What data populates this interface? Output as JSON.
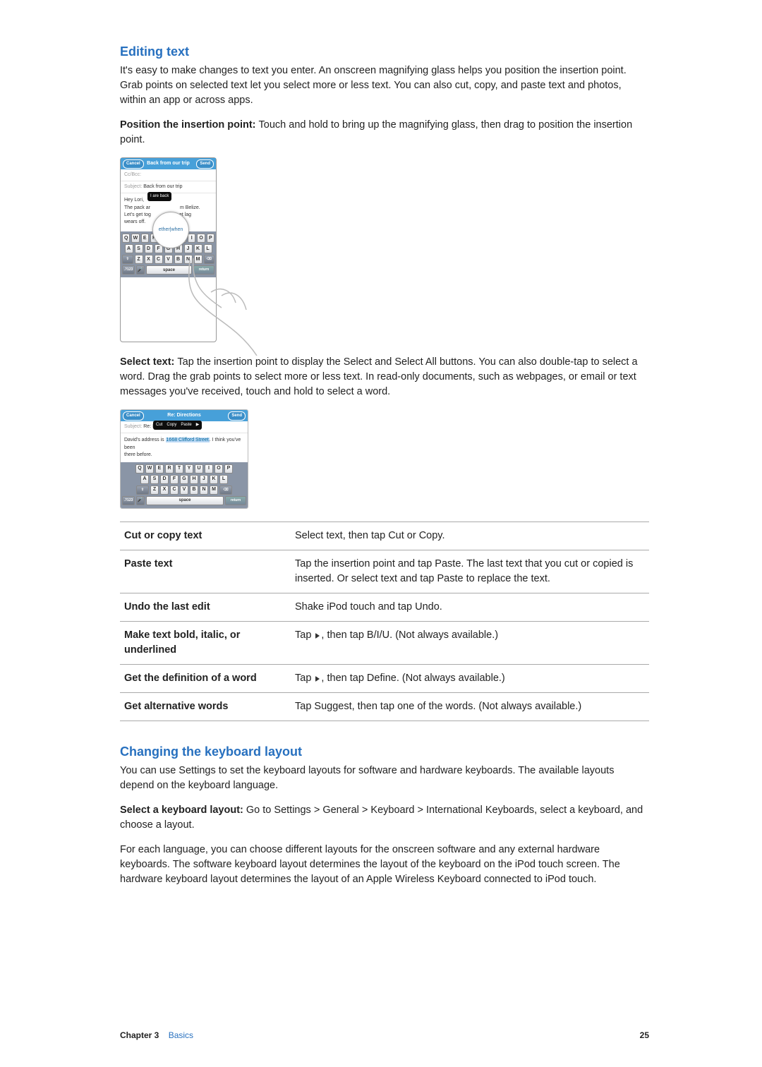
{
  "section1": {
    "heading": "Editing text",
    "intro": "It's easy to make changes to text you enter. An onscreen magnifying glass helps you position the insertion point. Grab points on selected text let you select more or less text. You can also cut, copy, and paste text and photos, within an app or across apps.",
    "pos_label": "Position the insertion point:  ",
    "pos_text": "Touch and hold to bring up the magnifying glass, then drag to position the insertion point.",
    "sel_label": "Select text:  ",
    "sel_text": "Tap the insertion point to display the Select and Select All buttons. You can also double-tap to select a word. Drag the grab points to select more or less text. In read-only documents, such as webpages, or email or text messages you've received, touch and hold to select a word."
  },
  "fig1": {
    "title": "Back from our trip",
    "cancel": "Cancel",
    "send": "Send",
    "cc": "Cc/Bcc:",
    "subj_label": "Subject:",
    "subj": "Back from our trip",
    "body1": "Hey Lori,",
    "body2": "The pack ar",
    "body3": "m Belize.",
    "body4": "Let's get tog",
    "body5": "et lag",
    "body6": "wears off.",
    "mag_text": "ether|when",
    "lookup": "I are back"
  },
  "fig2": {
    "title": "Re: Directions",
    "cancel": "Cancel",
    "send": "Send",
    "subj_label": "Subject:",
    "subj_pre": "Re: D",
    "cut": "Cut",
    "copy": "Copy",
    "paste": "Paste",
    "line1a": "David's address is ",
    "line1_sel": "1668 Clifford Street",
    "line1b": ". I think you've been",
    "line2": "there before.",
    "space": "space",
    "return": "return"
  },
  "table": [
    {
      "k": "Cut or copy text",
      "v": "Select text, then tap Cut or Copy."
    },
    {
      "k": "Paste text",
      "v": "Tap the insertion point and tap Paste. The last text that you cut or copied is inserted. Or select text and tap Paste to replace the text."
    },
    {
      "k": "Undo the last edit",
      "v": "Shake iPod touch and tap Undo."
    },
    {
      "k": "Make text bold, italic, or underlined",
      "v_pre": "Tap ",
      "v_post": ", then tap B/I/U. (Not always available.)"
    },
    {
      "k": "Get the definition of a word",
      "v_pre": "Tap ",
      "v_post": ", then tap Define. (Not always available.)"
    },
    {
      "k": "Get alternative words",
      "v": "Tap Suggest, then tap one of the words. (Not always available.)"
    }
  ],
  "section2": {
    "heading": "Changing the keyboard layout",
    "p1": "You can use Settings to set the keyboard layouts for software and hardware keyboards. The available layouts depend on the keyboard language.",
    "sel_label": "Select a keyboard layout:  ",
    "sel_text": "Go to Settings > General > Keyboard > International Keyboards, select a keyboard, and choose a layout.",
    "p3": "For each language, you can choose different layouts for the onscreen software and any external hardware keyboards. The software keyboard layout determines the layout of the keyboard on the iPod touch screen. The hardware keyboard layout determines the layout of an Apple Wireless Keyboard connected to iPod touch."
  },
  "footer": {
    "chap": "Chapter 3",
    "sec": "Basics",
    "page": "25"
  },
  "keys": {
    "r1": [
      "Q",
      "W",
      "E",
      "R",
      "T",
      "Y",
      "U",
      "I",
      "O",
      "P"
    ],
    "r2": [
      "A",
      "S",
      "D",
      "F",
      "G",
      "H",
      "J",
      "K",
      "L"
    ],
    "r3": [
      "Z",
      "X",
      "C",
      "V",
      "B",
      "N",
      "M"
    ]
  }
}
